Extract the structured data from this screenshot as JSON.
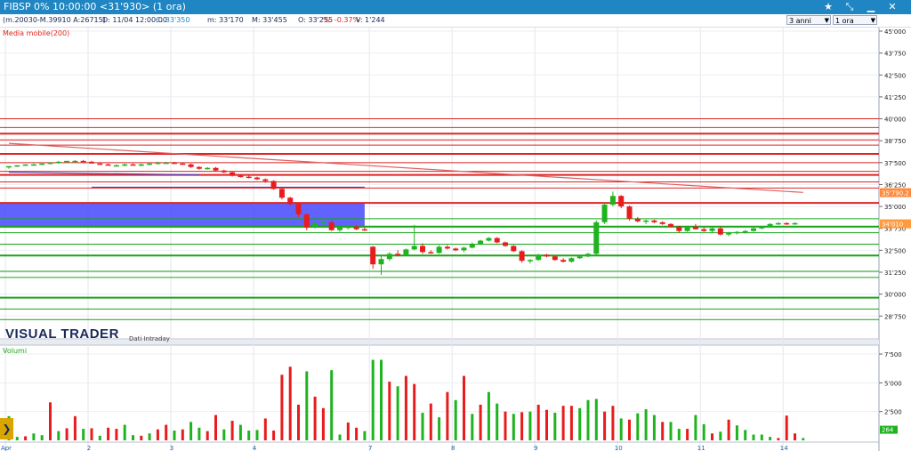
{
  "titlebar": {
    "title": "FIBSP 0% 10:00:00  <31'930> (1 ora)",
    "icons": [
      "star-icon",
      "pin-icon",
      "minimize-icon",
      "close-icon"
    ]
  },
  "infobar": {
    "range": "(m.20030-M.39910 A:26715)",
    "datetime": "D: 11/04 12:00:00",
    "close_label": "C: 33'350",
    "min": "m: 33'170",
    "max": "M: 33'455",
    "open": "O: 33'255",
    "change": "%: -0.37%",
    "volume": "V: 1'244",
    "period_select": "3 anni",
    "interval_select": "1 ora"
  },
  "labels": {
    "moving_average": "Media mobile(200)",
    "volume": "Volumi",
    "brand": "VISUAL TRADER",
    "data_source": "Dati Intraday"
  },
  "colors": {
    "up": "#1fb31f",
    "down": "#e81c1c",
    "support": "#19a319",
    "resistance": "#e02424",
    "zone": "#4646ff",
    "ma": "#e06060",
    "trend": "#5a3fb5",
    "titlebar": "#1f86c3"
  },
  "chart_data": [
    {
      "type": "candlestick",
      "title": "FIBSP",
      "y_ticks": [
        28750,
        30000,
        31250,
        32500,
        33750,
        35000,
        36250,
        37500,
        38750,
        40000,
        41250,
        42500,
        43750,
        45000
      ],
      "y_tick_labels": [
        "28'750",
        "30'000",
        "31'250",
        "32'500",
        "33'750",
        "35'000",
        "36'250",
        "37'500",
        "38'750",
        "40'000",
        "41'250",
        "42'500",
        "43'750",
        "45'000"
      ],
      "ylim": [
        27750,
        45000
      ],
      "x_labels": [
        "Apr",
        "2",
        "3",
        "4",
        "7",
        "8",
        "9",
        "10",
        "11",
        "14"
      ],
      "x_label_index": [
        0,
        10,
        20,
        30,
        44,
        54,
        64,
        74,
        84,
        94
      ],
      "price_tags": [
        {
          "value": 35790,
          "label": "35'790.2",
          "color": "#ff8a3d"
        },
        {
          "value": 34010,
          "label": "34'010",
          "color": "#ff9a3d"
        }
      ],
      "resistance_lines": [
        40000,
        39500,
        39150,
        38800,
        38500,
        38000,
        37500,
        37000,
        36800,
        36400,
        36050,
        35200
      ],
      "support_lines": [
        34300,
        33850,
        33500,
        32850,
        32200,
        31300,
        30950,
        29800,
        29150,
        28550
      ],
      "zone": {
        "from_index": 0,
        "to_index": 43,
        "low": 33800,
        "high": 35200
      },
      "trend_segments": [
        {
          "from_index": 0,
          "y0": 36950,
          "to_index": 23,
          "y1": 36800
        },
        {
          "from_index": 10,
          "y0": 36100,
          "to_index": 43,
          "y1": 36100
        }
      ],
      "moving_average": {
        "name": "Media mobile(200)",
        "from_index": 0,
        "y0": 38600,
        "to_index": 96,
        "y1": 35800
      },
      "candles": [
        [
          37250,
          37300,
          37150,
          37300
        ],
        [
          37300,
          37350,
          37250,
          37350
        ],
        [
          37350,
          37400,
          37300,
          37400
        ],
        [
          37400,
          37450,
          37350,
          37400
        ],
        [
          37400,
          37450,
          37350,
          37450
        ],
        [
          37450,
          37500,
          37400,
          37500
        ],
        [
          37500,
          37600,
          37450,
          37550
        ],
        [
          37550,
          37600,
          37500,
          37600
        ],
        [
          37600,
          37650,
          37550,
          37600
        ],
        [
          37600,
          37650,
          37550,
          37550
        ],
        [
          37550,
          37600,
          37450,
          37450
        ],
        [
          37450,
          37500,
          37400,
          37400
        ],
        [
          37400,
          37450,
          37350,
          37350
        ],
        [
          37350,
          37400,
          37300,
          37350
        ],
        [
          37350,
          37450,
          37300,
          37400
        ],
        [
          37400,
          37450,
          37350,
          37350
        ],
        [
          37350,
          37450,
          37300,
          37400
        ],
        [
          37400,
          37500,
          37350,
          37450
        ],
        [
          37450,
          37550,
          37400,
          37500
        ],
        [
          37500,
          37550,
          37450,
          37500
        ],
        [
          37500,
          37550,
          37450,
          37450
        ],
        [
          37450,
          37500,
          37400,
          37400
        ],
        [
          37400,
          37450,
          37200,
          37250
        ],
        [
          37250,
          37300,
          37100,
          37150
        ],
        [
          37150,
          37250,
          37100,
          37200
        ],
        [
          37200,
          37250,
          37000,
          37050
        ],
        [
          37050,
          37100,
          36900,
          36950
        ],
        [
          36950,
          37000,
          36700,
          36750
        ],
        [
          36750,
          36850,
          36650,
          36700
        ],
        [
          36700,
          36800,
          36600,
          36650
        ],
        [
          36650,
          36700,
          36500,
          36550
        ],
        [
          36550,
          36600,
          36350,
          36450
        ],
        [
          36450,
          36500,
          35950,
          36000
        ],
        [
          36000,
          36050,
          35400,
          35500
        ],
        [
          35500,
          35550,
          35050,
          35150
        ],
        [
          35150,
          35200,
          34400,
          34550
        ],
        [
          34550,
          34600,
          33650,
          33800
        ],
        [
          33800,
          34150,
          33750,
          34050
        ],
        [
          34050,
          34250,
          33900,
          34100
        ],
        [
          34100,
          34200,
          33600,
          33650
        ],
        [
          33650,
          33900,
          33550,
          33800
        ],
        [
          33800,
          33950,
          33700,
          33850
        ],
        [
          33850,
          33950,
          33650,
          33700
        ],
        [
          33700,
          33800,
          33600,
          33650
        ],
        [
          32700,
          32750,
          31450,
          31700
        ],
        [
          31700,
          32200,
          31100,
          32000
        ],
        [
          32000,
          32400,
          31900,
          32300
        ],
        [
          32300,
          32500,
          32150,
          32250
        ],
        [
          32250,
          32600,
          32200,
          32550
        ],
        [
          32550,
          33950,
          32500,
          32750
        ],
        [
          32750,
          32900,
          32300,
          32400
        ],
        [
          32400,
          32500,
          32300,
          32350
        ],
        [
          32350,
          32800,
          32300,
          32700
        ],
        [
          32700,
          32800,
          32550,
          32600
        ],
        [
          32600,
          32650,
          32450,
          32500
        ],
        [
          32500,
          32700,
          32400,
          32650
        ],
        [
          32650,
          32950,
          32600,
          32850
        ],
        [
          32850,
          33100,
          32800,
          33050
        ],
        [
          33050,
          33250,
          33000,
          33200
        ],
        [
          33200,
          33250,
          32900,
          32950
        ],
        [
          32950,
          33000,
          32700,
          32750
        ],
        [
          32750,
          32800,
          32400,
          32450
        ],
        [
          32450,
          32500,
          31800,
          31900
        ],
        [
          31900,
          32000,
          31750,
          31950
        ],
        [
          31950,
          32300,
          31900,
          32250
        ],
        [
          32250,
          32300,
          32100,
          32150
        ],
        [
          32150,
          32200,
          31900,
          31950
        ],
        [
          31950,
          32050,
          31800,
          31850
        ],
        [
          31850,
          32100,
          31800,
          32050
        ],
        [
          32050,
          32200,
          32000,
          32150
        ],
        [
          32150,
          32350,
          32100,
          32300
        ],
        [
          32300,
          34200,
          32250,
          34100
        ],
        [
          34100,
          35200,
          34000,
          35100
        ],
        [
          35100,
          35850,
          35000,
          35600
        ],
        [
          35600,
          35650,
          34900,
          35000
        ],
        [
          35000,
          35050,
          34200,
          34300
        ],
        [
          34300,
          34400,
          34100,
          34150
        ],
        [
          34150,
          34250,
          34000,
          34200
        ],
        [
          34200,
          34250,
          34050,
          34100
        ],
        [
          34100,
          34150,
          33950,
          34000
        ],
        [
          34000,
          34050,
          33800,
          33850
        ],
        [
          33850,
          33900,
          33500,
          33600
        ],
        [
          33600,
          33900,
          33550,
          33850
        ],
        [
          33850,
          34000,
          33700,
          33700
        ],
        [
          33700,
          33800,
          33550,
          33600
        ],
        [
          33600,
          33800,
          33500,
          33750
        ],
        [
          33750,
          33850,
          33350,
          33400
        ],
        [
          33400,
          33550,
          33300,
          33500
        ],
        [
          33500,
          33600,
          33400,
          33550
        ],
        [
          33550,
          33650,
          33450,
          33600
        ],
        [
          33600,
          33800,
          33550,
          33750
        ],
        [
          33750,
          33900,
          33700,
          33850
        ],
        [
          33850,
          34050,
          33800,
          34000
        ],
        [
          34000,
          34100,
          33950,
          34050
        ],
        [
          34050,
          34100,
          33950,
          34000
        ],
        [
          34000,
          34100,
          33950,
          34050
        ]
      ]
    },
    {
      "type": "bar",
      "title": "Volumi",
      "y_ticks": [
        0,
        2500,
        5000,
        7500
      ],
      "y_tick_labels": [
        "",
        "2'500",
        "5'000",
        "7'500"
      ],
      "ylim": [
        0,
        8200
      ],
      "last_value_label": "264",
      "values": [
        2100,
        300,
        350,
        600,
        450,
        3300,
        800,
        1050,
        2100,
        1000,
        1050,
        400,
        1100,
        1000,
        1350,
        450,
        400,
        600,
        950,
        1350,
        850,
        950,
        1600,
        1100,
        800,
        2200,
        950,
        1700,
        1350,
        850,
        900,
        1900,
        850,
        5700,
        6400,
        3100,
        6000,
        3800,
        2800,
        6100,
        500,
        1550,
        1100,
        800,
        7000,
        7000,
        5100,
        4700,
        5600,
        4900,
        2400,
        3200,
        2000,
        4200,
        3500,
        5600,
        2300,
        3100,
        4200,
        3200,
        2500,
        2300,
        2450,
        2500,
        3100,
        2650,
        2400,
        3000,
        3000,
        2800,
        3500,
        3600,
        2500,
        3000,
        1900,
        1800,
        2350,
        2700,
        2200,
        1600,
        1600,
        1000,
        1000,
        2200,
        1400,
        600,
        750,
        1800,
        1300,
        900,
        500,
        500,
        300,
        200,
        2150,
        600,
        200
      ],
      "colors": [
        "up",
        "up",
        "down",
        "up",
        "up",
        "down",
        "up",
        "down",
        "down",
        "up",
        "down",
        "up",
        "down",
        "down",
        "up",
        "up",
        "down",
        "up",
        "down",
        "down",
        "up",
        "down",
        "up",
        "up",
        "down",
        "down",
        "up",
        "down",
        "up",
        "up",
        "up",
        "down",
        "down",
        "down",
        "down",
        "down",
        "up",
        "down",
        "down",
        "up",
        "up",
        "down",
        "down",
        "up",
        "up",
        "up",
        "down",
        "up",
        "down",
        "down",
        "up",
        "down",
        "up",
        "down",
        "up",
        "down",
        "up",
        "down",
        "up",
        "up",
        "down",
        "up",
        "down",
        "up",
        "down",
        "down",
        "up",
        "down",
        "down",
        "up",
        "up",
        "up",
        "down",
        "down",
        "up",
        "down",
        "up",
        "up",
        "up",
        "down",
        "up",
        "up",
        "down",
        "up",
        "up",
        "down",
        "up",
        "down",
        "up",
        "up",
        "up",
        "up",
        "up",
        "down",
        "down",
        "down",
        "up"
      ]
    }
  ]
}
